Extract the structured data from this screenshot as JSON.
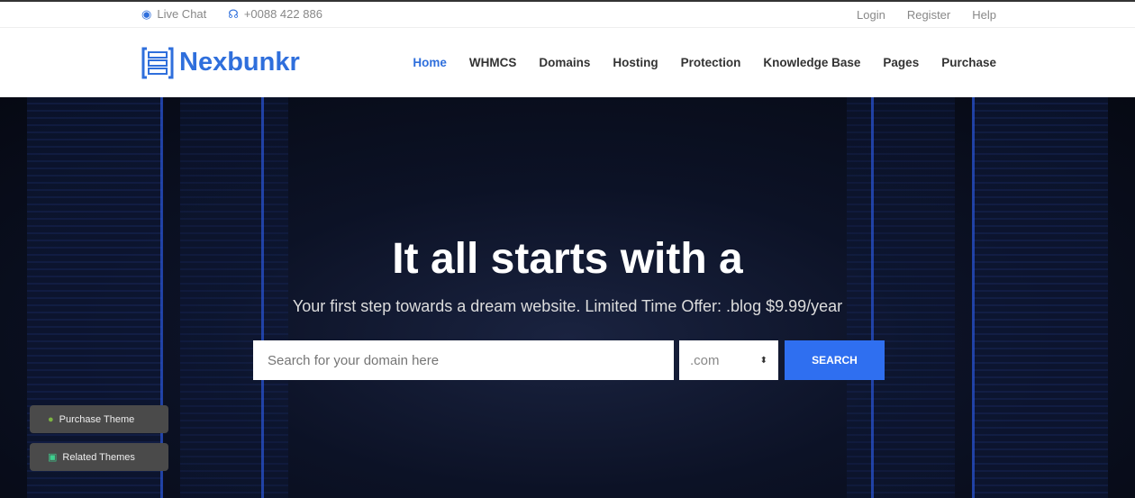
{
  "topbar": {
    "live_chat": "Live Chat",
    "phone": "+0088 422 886",
    "login": "Login",
    "register": "Register",
    "help": "Help"
  },
  "brand": {
    "name": "Nexbunkr",
    "color": "#2f6fdc"
  },
  "nav": [
    {
      "label": "Home",
      "active": true
    },
    {
      "label": "WHMCS"
    },
    {
      "label": "Domains"
    },
    {
      "label": "Hosting"
    },
    {
      "label": "Protection"
    },
    {
      "label": "Knowledge Base"
    },
    {
      "label": "Pages"
    },
    {
      "label": "Purchase"
    }
  ],
  "hero": {
    "title": "It all starts with a",
    "subtitle": "Your first step towards a dream website. Limited Time Offer: .blog $9.99/year",
    "search_placeholder": "Search for your domain here",
    "tld": ".com",
    "search_button": "SEARCH"
  },
  "floating": {
    "purchase": "Purchase Theme",
    "related": "Related Themes"
  }
}
